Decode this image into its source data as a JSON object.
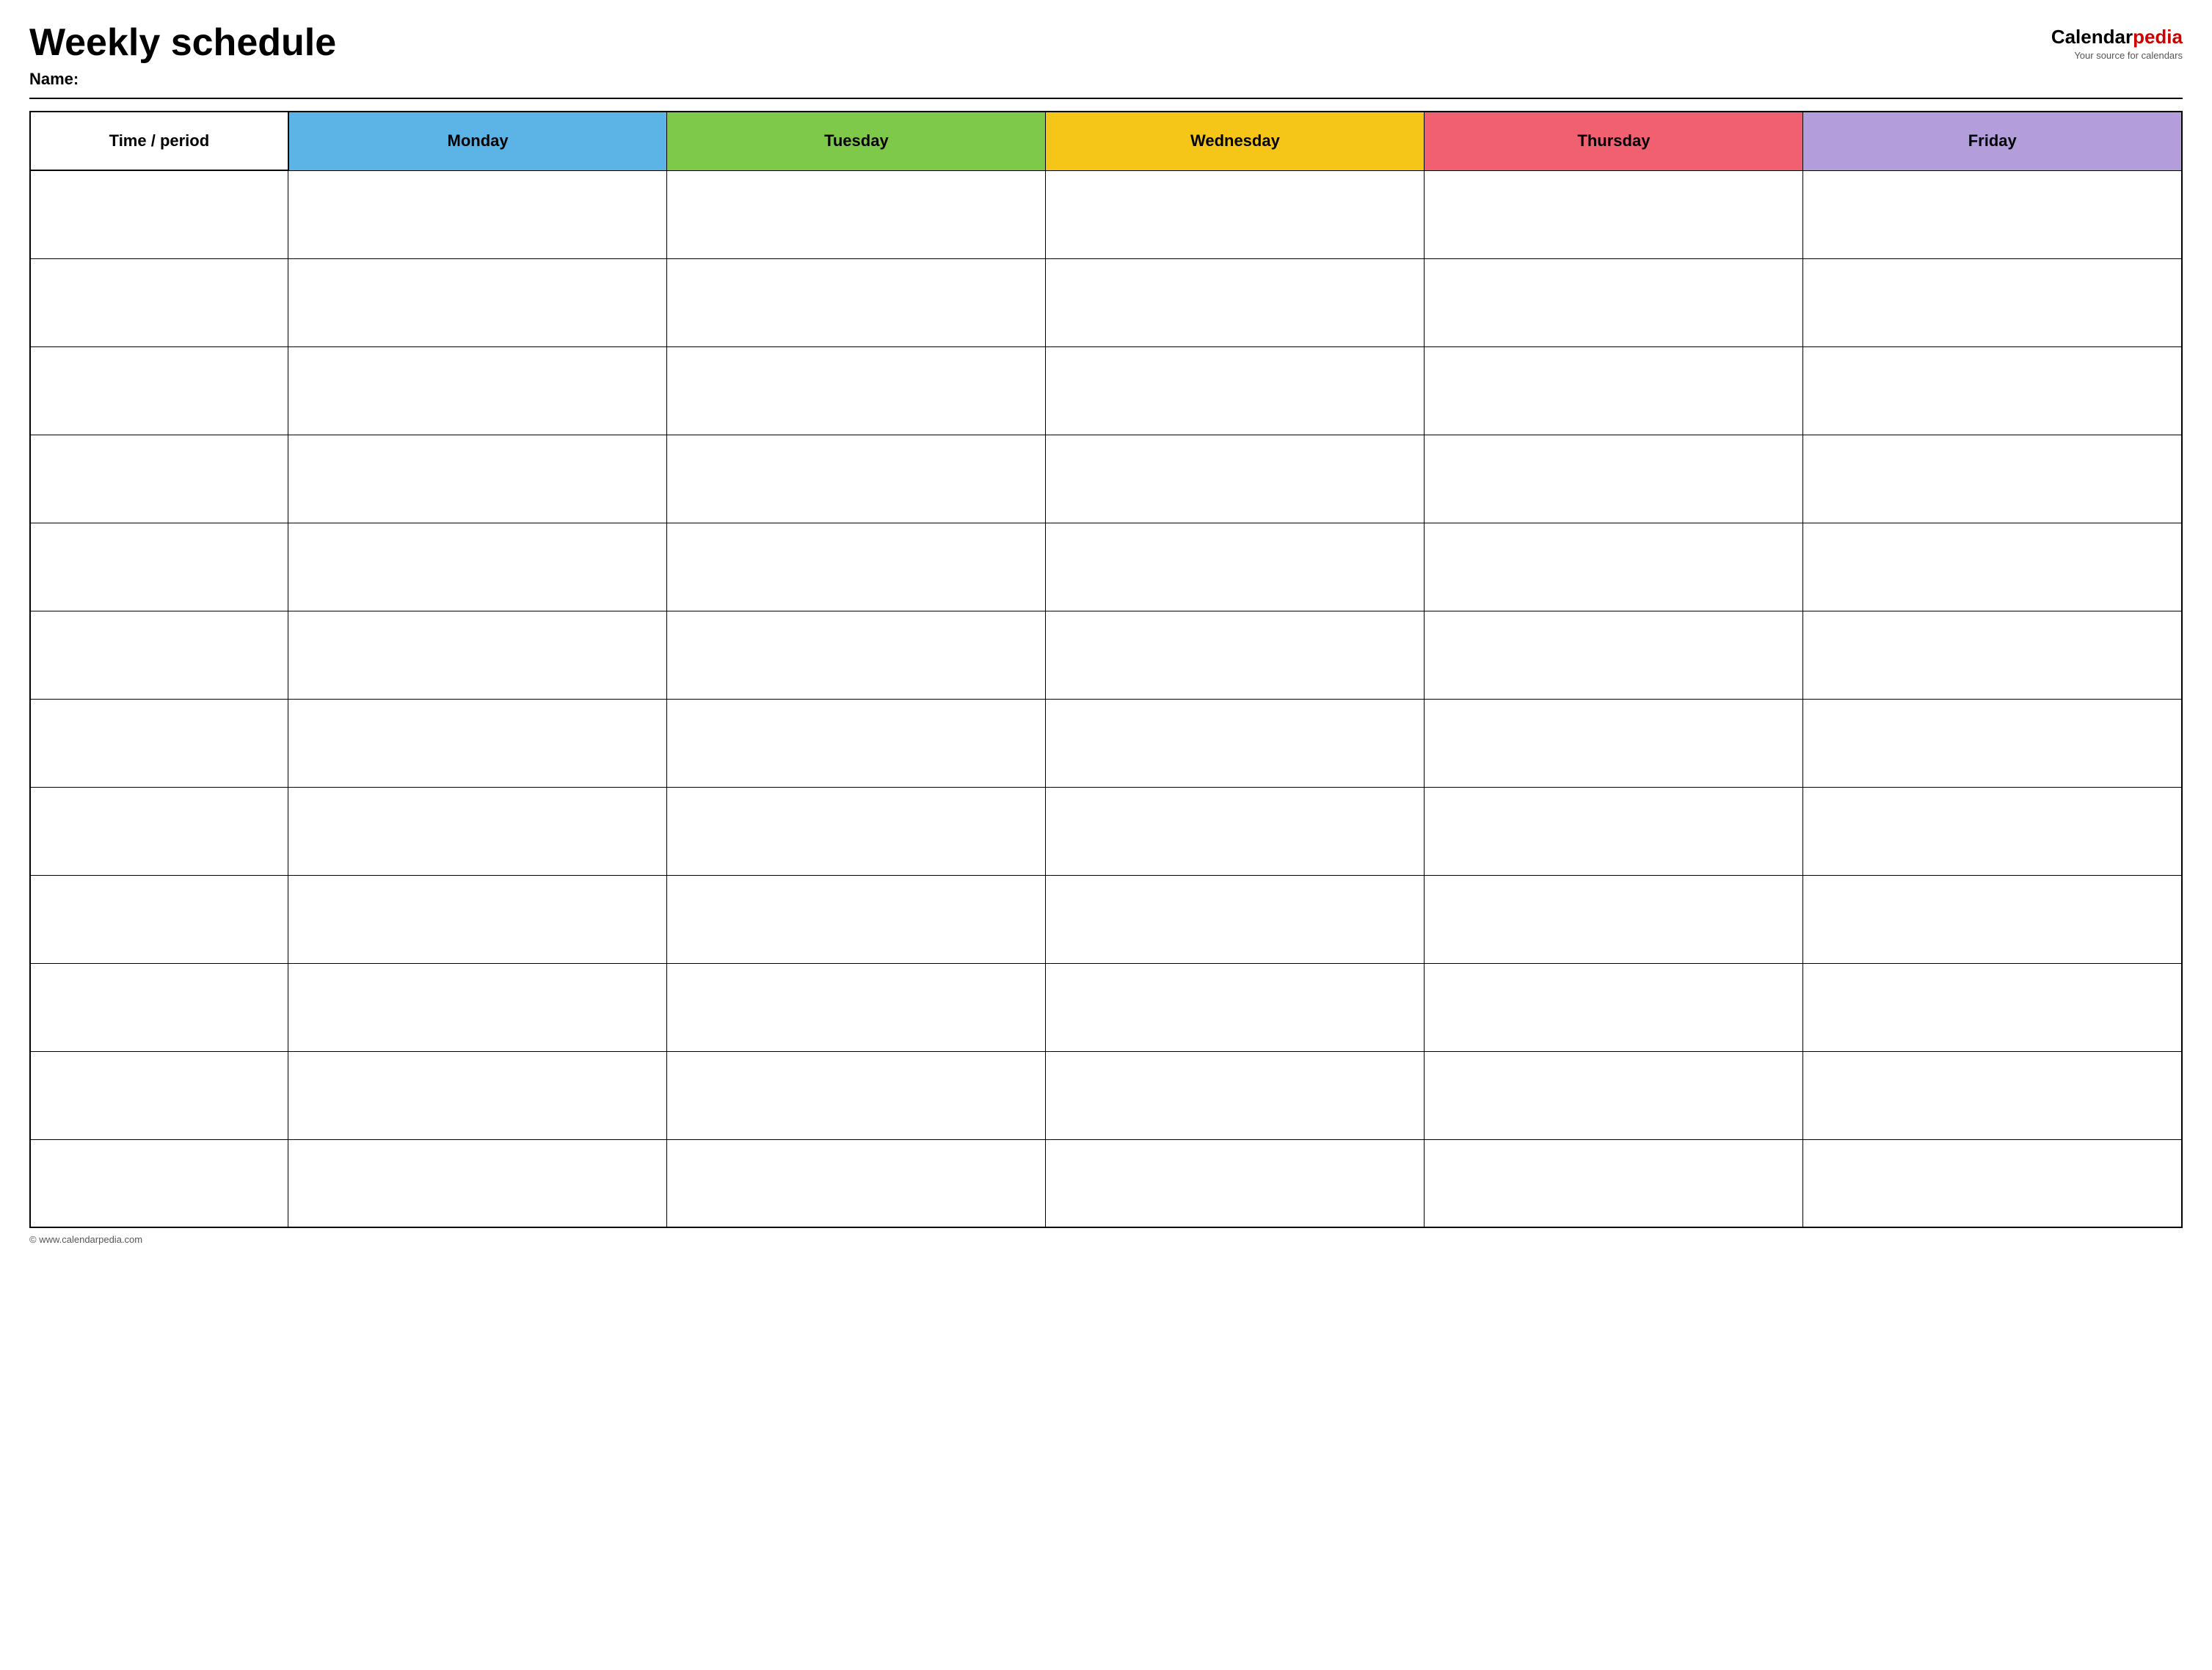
{
  "header": {
    "title": "Weekly schedule",
    "name_label": "Name:",
    "logo": {
      "calendar_text": "Calendar",
      "pedia_text": "pedia",
      "tagline": "Your source for calendars"
    }
  },
  "table": {
    "columns": [
      {
        "id": "time",
        "label": "Time / period",
        "class": "col-time",
        "header_class": "col-time"
      },
      {
        "id": "monday",
        "label": "Monday",
        "class": "col-day monday",
        "header_class": "monday"
      },
      {
        "id": "tuesday",
        "label": "Tuesday",
        "class": "col-day tuesday",
        "header_class": "tuesday"
      },
      {
        "id": "wednesday",
        "label": "Wednesday",
        "class": "col-day wednesday",
        "header_class": "wednesday"
      },
      {
        "id": "thursday",
        "label": "Thursday",
        "class": "col-day thursday",
        "header_class": "thursday"
      },
      {
        "id": "friday",
        "label": "Friday",
        "class": "col-day friday",
        "header_class": "friday"
      }
    ],
    "row_count": 12
  },
  "footer": {
    "text": "© www.calendarpedia.com"
  }
}
